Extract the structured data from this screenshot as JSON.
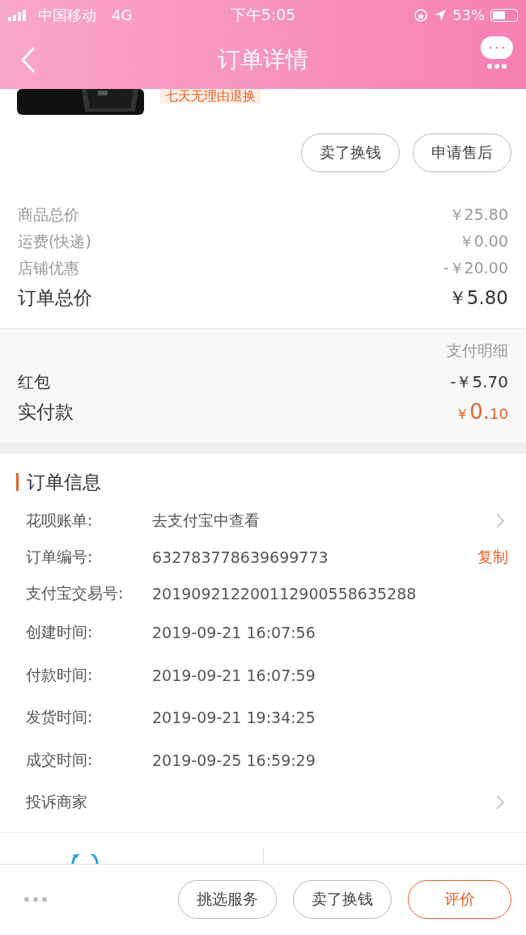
{
  "status_bar": {
    "carrier": "中国移动",
    "network": "4G",
    "time": "下午5:05",
    "battery_text": "53%"
  },
  "nav": {
    "title": "订单详情"
  },
  "product": {
    "tag": "七天无理由退换"
  },
  "item_actions": [
    "卖了换钱",
    "申请售后"
  ],
  "price_rows": [
    {
      "label": "商品总价",
      "value": "￥25.80",
      "kind": "minor"
    },
    {
      "label": "运费(快递)",
      "value": "￥0.00",
      "kind": "minor"
    },
    {
      "label": "店铺优惠",
      "value": "-￥20.00",
      "kind": "minor"
    },
    {
      "label": "订单总价",
      "value": "￥5.80",
      "kind": "total"
    }
  ],
  "payment": {
    "detail_link": "支付明细",
    "red_packet_label": "红包",
    "red_packet_value": "-￥5.70",
    "paid_label": "实付款",
    "paid_symbol": "￥",
    "paid_integer": "0.",
    "paid_decimal": "10"
  },
  "order_info": {
    "title": "订单信息",
    "rows": [
      {
        "label": "花呗账单:",
        "value": "去支付宝中查看",
        "kind": "link"
      },
      {
        "label": "订单编号:",
        "value": "632783778639699773",
        "kind": "copy",
        "action": "复制"
      },
      {
        "label": "支付宝交易号:",
        "value": "201909212200112900558635288",
        "kind": "plain"
      },
      {
        "label": "创建时间:",
        "value": "2019-09-21 16:07:56",
        "kind": "plain"
      },
      {
        "label": "付款时间:",
        "value": "2019-09-21 16:07:59",
        "kind": "plain"
      },
      {
        "label": "发货时间:",
        "value": "2019-09-21 19:34:25",
        "kind": "plain"
      },
      {
        "label": "成交时间:",
        "value": "2019-09-25 16:59:29",
        "kind": "plain"
      },
      {
        "label": "投诉商家",
        "kind": "link"
      }
    ]
  },
  "bottom_bar": {
    "buttons": [
      {
        "label": "挑选服务",
        "kind": "normal"
      },
      {
        "label": "卖了换钱",
        "kind": "normal"
      },
      {
        "label": "评价",
        "kind": "primary"
      }
    ]
  }
}
